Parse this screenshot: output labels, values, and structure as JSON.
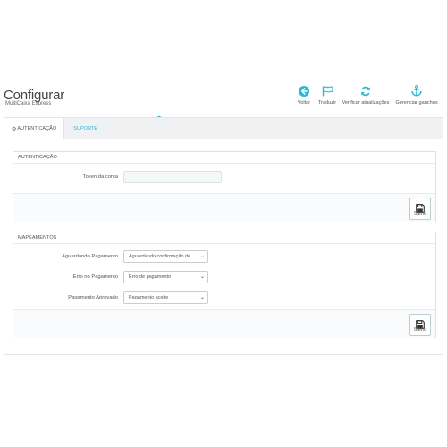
{
  "header": {
    "title": "Configurar",
    "subtitle": "MultiCaixa Express"
  },
  "toolbar": {
    "back_label": "Voltar",
    "translate_label": "Traduzir",
    "check_updates_label": "Verificar atualizações",
    "manage_hooks_label": "Gerenciar ganchos",
    "icon_color": "#25b9d7"
  },
  "tabs": [
    {
      "label": "AUTENTICAÇÃO",
      "active": true
    },
    {
      "label": "SUPORTE",
      "active": false
    }
  ],
  "auth_card": {
    "title": "AUTENTICAÇÃO",
    "token_label": "Token da conta",
    "token_value": "",
    "save_label": "Salvar"
  },
  "mapping_card": {
    "title": "MAPEAMENTOS",
    "rows": [
      {
        "label": "Aguardando Pagamento",
        "value": "Aguardando confirmação de"
      },
      {
        "label": "Erro no Pagamento",
        "value": "Erro de pagamento"
      },
      {
        "label": "Pagamento Aprovado",
        "value": "Pagamento aceite"
      }
    ],
    "save_label": "Salvar"
  }
}
